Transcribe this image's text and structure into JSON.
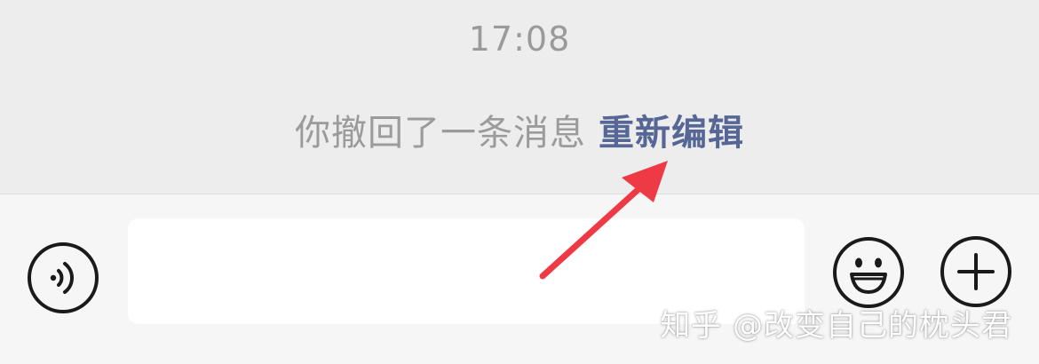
{
  "chat": {
    "timestamp": "17:08",
    "recall_notice": "你撤回了一条消息",
    "reedit_label": "重新编辑"
  },
  "input_bar": {
    "voice_icon": "voice-icon",
    "message_value": "",
    "emoji_icon": "emoji-icon",
    "plus_icon": "plus-icon"
  },
  "annotation": {
    "arrow_color": "#ee3a45"
  },
  "watermark": {
    "text": "知乎 @改变自己的枕头君"
  },
  "colors": {
    "chat_bg": "#ededed",
    "input_bar_bg": "#f6f6f6",
    "gray_text": "#9b9b9b",
    "link_text": "#566796"
  }
}
